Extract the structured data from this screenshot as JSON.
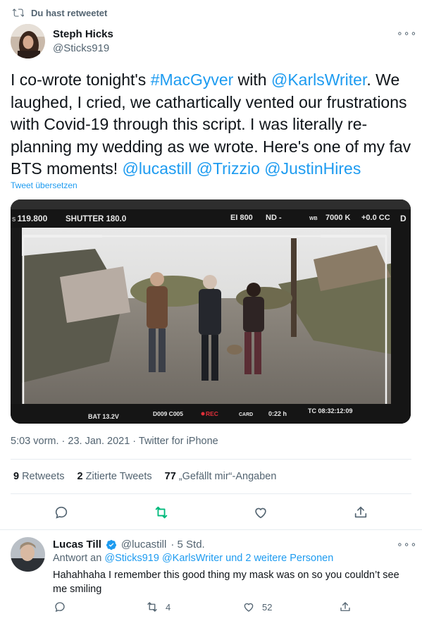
{
  "retweet_banner": {
    "label": "Du hast retweetet"
  },
  "author": {
    "name": "Steph Hicks",
    "handle": "@Sticks919"
  },
  "tweet": {
    "text_parts": [
      {
        "t": "I co-wrote tonight's ",
        "link": false
      },
      {
        "t": "#MacGyver",
        "link": true
      },
      {
        "t": " with ",
        "link": false
      },
      {
        "t": "@KarlsWriter",
        "link": true
      },
      {
        "t": ". We laughed, I cried, we cathartically vented our frustrations with Covid-19 through this script. I was literally re-planning my wedding as we wrote. Here's one of my fav BTS moments! ",
        "link": false
      },
      {
        "t": "@lucastill",
        "link": true
      },
      {
        "t": " ",
        "link": false
      },
      {
        "t": "@Trizzio",
        "link": true
      },
      {
        "t": " ",
        "link": false
      },
      {
        "t": "@JustinHires",
        "link": true
      }
    ],
    "translate_label": "Tweet übersetzen",
    "timestamp": "5:03 vorm. · 23. Jan. 2021 · Twitter for iPhone"
  },
  "media": {
    "hud": {
      "iso_value": "119.800",
      "shutter": "SHUTTER 180.0",
      "ei": "EI 800",
      "nd": "ND -",
      "wb_label": "WB",
      "wb": "7000 K",
      "cc": "+0.0 CC",
      "d": "D",
      "bat": "BAT 13.2V",
      "clip": "D009 C005",
      "rec": "REC",
      "card": "CARD",
      "remain": "0:22 h",
      "tc": "TC 08:32:12:09"
    }
  },
  "stats": {
    "retweets_count": "9",
    "retweets_label": "Retweets",
    "quotes_count": "2",
    "quotes_label": "Zitierte Tweets",
    "likes_count": "77",
    "likes_label": "„Gefällt mir“-Angaben"
  },
  "reply": {
    "name": "Lucas Till",
    "handle": "@lucastill",
    "time": "· 5 Std.",
    "reply_to_prefix": "Antwort an ",
    "reply_to_targets": "@Sticks919 @KarlsWriter und 2 weitere Personen",
    "text": "Hahahhaha I remember this good thing my mask was on so you couldn’t see me smiling",
    "retweet_count": "4",
    "like_count": "52"
  },
  "colors": {
    "accent": "#1d9bf0",
    "retweet_active": "#00ba7c",
    "muted": "#536471"
  }
}
